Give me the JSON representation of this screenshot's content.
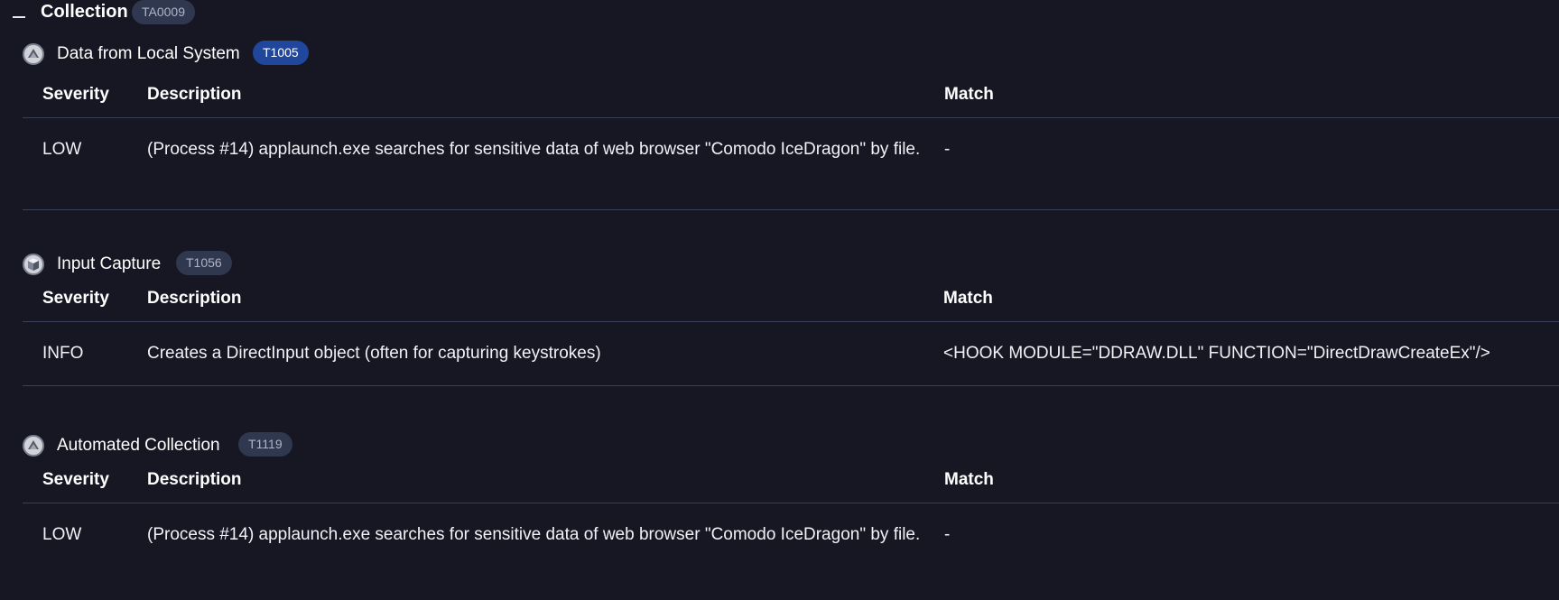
{
  "tactic": {
    "title": "Collection",
    "id": "TA0009"
  },
  "columns": {
    "severity": "Severity",
    "description": "Description",
    "match": "Match"
  },
  "techniques": [
    {
      "title": "Data from Local System",
      "id": "T1005",
      "icon": "pyramid-icon",
      "badge_active": true,
      "rows": [
        {
          "severity": "LOW",
          "description": "(Process #14) applaunch.exe searches for sensitive data of web browser \"Comodo IceDragon\" by file.",
          "match": "-"
        }
      ]
    },
    {
      "title": "Input Capture",
      "id": "T1056",
      "icon": "cube-icon",
      "badge_active": false,
      "rows": [
        {
          "severity": "INFO",
          "description": "Creates a DirectInput object (often for capturing keystrokes)",
          "match": "<HOOK MODULE=\"DDRAW.DLL\" FUNCTION=\"DirectDrawCreateEx\"/>"
        }
      ]
    },
    {
      "title": "Automated Collection",
      "id": "T1119",
      "icon": "pyramid-icon",
      "badge_active": false,
      "rows": [
        {
          "severity": "LOW",
          "description": "(Process #14) applaunch.exe searches for sensitive data of web browser \"Comodo IceDragon\" by file.",
          "match": "-"
        }
      ]
    }
  ]
}
